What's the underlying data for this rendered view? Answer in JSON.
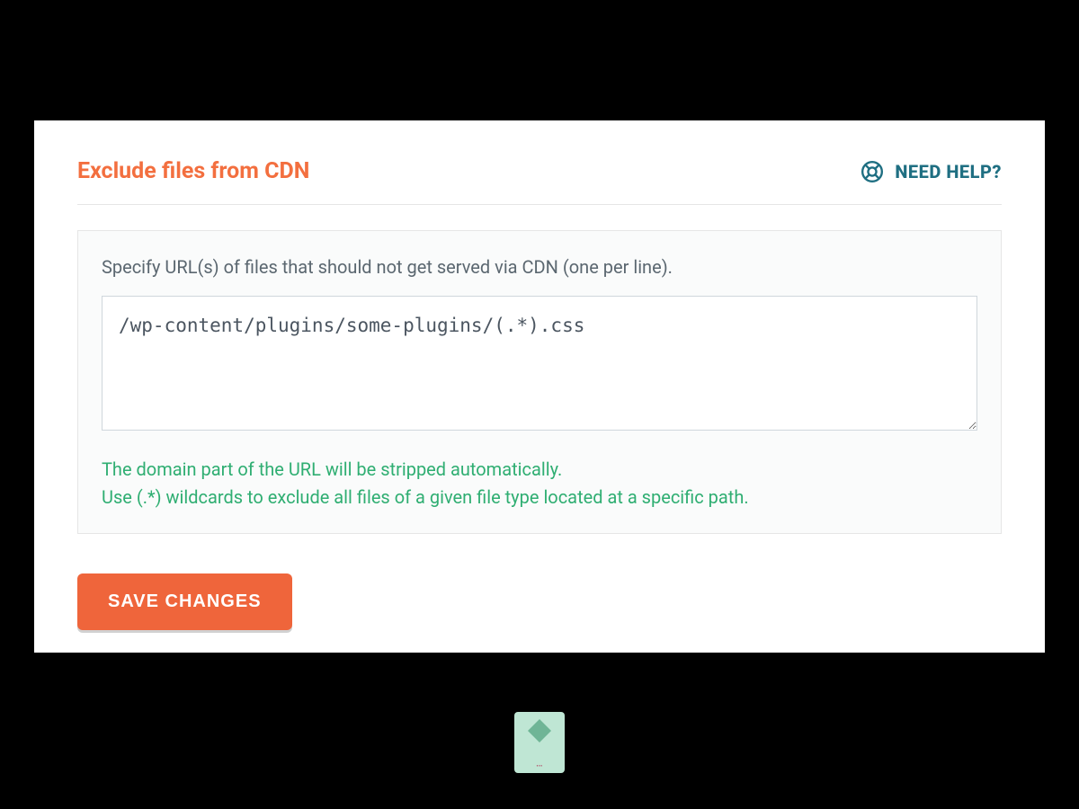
{
  "page": {
    "top_heading": "Exclude Files From CDN"
  },
  "header": {
    "title": "Exclude files from CDN",
    "help_label": "NEED HELP?"
  },
  "form": {
    "label": "Specify URL(s) of files that should not get served via CDN (one per line).",
    "value": "/wp-content/plugins/some-plugins/(.*).css",
    "hint_line1": "The domain part of the URL will be stripped automatically.",
    "hint_line2": "Use (.*) wildcards to exclude all files of a given file type located at a specific path."
  },
  "actions": {
    "save_label": "SAVE CHANGES"
  },
  "colors": {
    "accent_orange": "#f36f3f",
    "button_orange": "#ef653b",
    "hint_green": "#2fae72",
    "help_teal": "#1f6f82"
  }
}
